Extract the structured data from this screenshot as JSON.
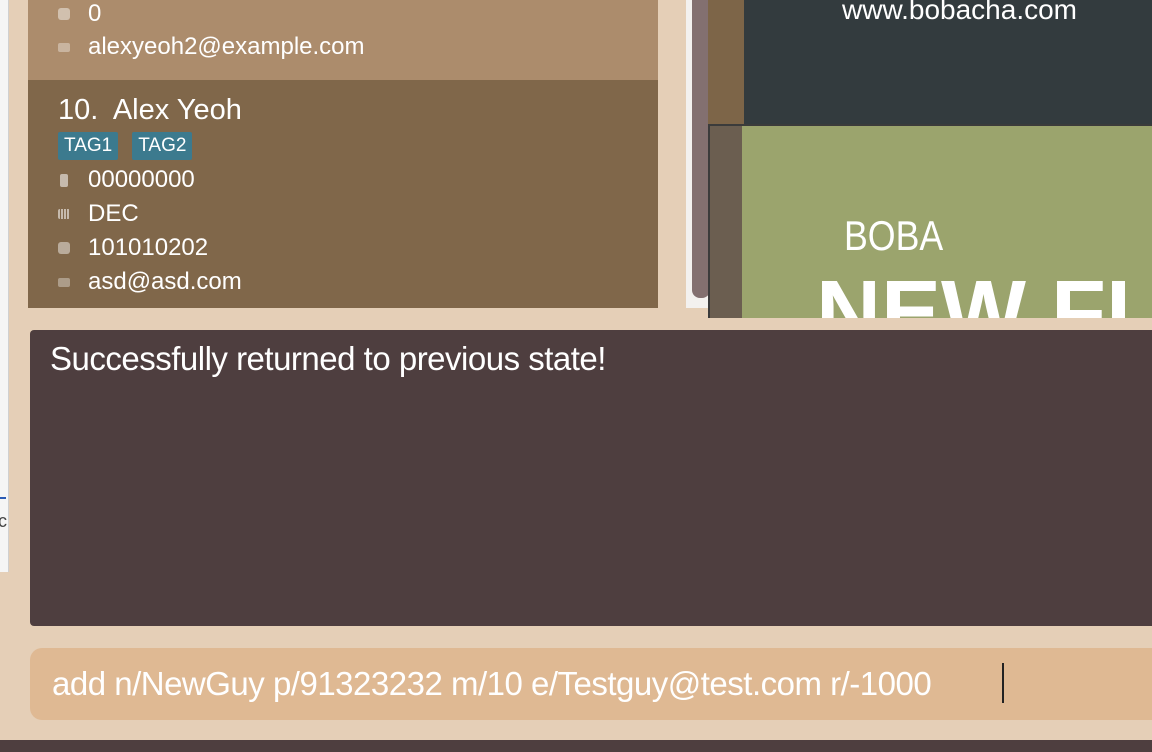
{
  "window": {
    "left_glyph": "c"
  },
  "person_list": {
    "previous_card": {
      "address": "0",
      "email": "alexyeoh2@example.com"
    },
    "current_card": {
      "index": "10.",
      "name": "Alex Yeoh",
      "tags": [
        "TAG1",
        "TAG2"
      ],
      "phone": "00000000",
      "month": "DEC",
      "address": "101010202",
      "email": "asd@asd.com"
    }
  },
  "promo": {
    "url": "www.bobacha.com",
    "brand": "BOBA",
    "headline": "NEW FLA"
  },
  "result_display": {
    "message": "Successfully returned to previous state!"
  },
  "command_box": {
    "value": "add n/NewGuy p/91323232 m/10 e/Testguy@test.com r/-1000"
  },
  "icons": {
    "phone": "phone-icon",
    "month": "calendar-icon",
    "address": "box-icon",
    "email": "mail-icon"
  },
  "colors": {
    "background": "#e5cfb7",
    "card_selected": "#ac8c6c",
    "card": "#80674a",
    "tag": "#3c7a8e",
    "result_bg": "#4e3e3f",
    "command_bg": "#dfb993"
  }
}
